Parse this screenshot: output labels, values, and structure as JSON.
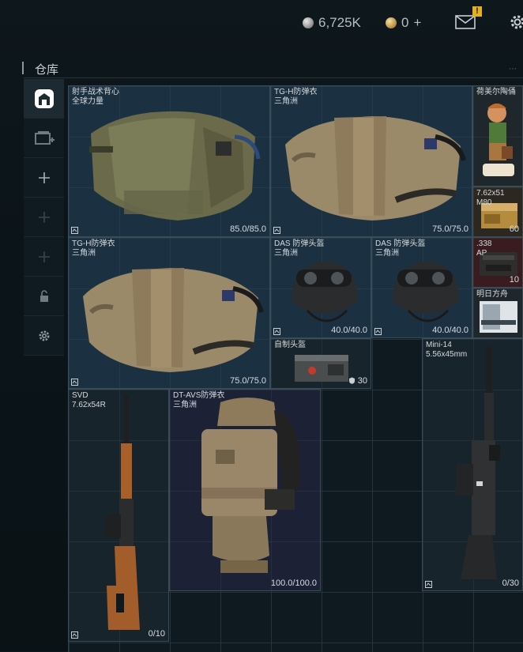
{
  "header": {
    "roubles": "6,725K",
    "coins": "0",
    "coins_add": "+",
    "mail_badge": "!",
    "icons": [
      "silver-coin-icon",
      "gold-coin-icon",
      "mail-icon",
      "settings-icon"
    ]
  },
  "section": {
    "title": "仓库",
    "dots": "⋯"
  },
  "sidebar": {
    "items": [
      {
        "name": "warehouse-tab",
        "icon": "warehouse-icon",
        "active": true
      },
      {
        "name": "add-storage-tab",
        "icon": "add-card-icon"
      },
      {
        "name": "add-slot-1",
        "icon": "plus-icon"
      },
      {
        "name": "add-slot-2",
        "icon": "plus-icon"
      },
      {
        "name": "add-slot-3",
        "icon": "plus-icon"
      },
      {
        "name": "lock-tab",
        "icon": "lock-icon"
      },
      {
        "name": "settings-tab",
        "icon": "gear-icon"
      }
    ]
  },
  "items": {
    "vest1": {
      "line1": "射手战术背心",
      "line2": "全球力量",
      "durability": "85.0/85.0"
    },
    "vest2": {
      "line1": "TG-H防弹衣",
      "line2": "三角洲",
      "durability": "75.0/75.0"
    },
    "vest3": {
      "line1": "TG-H防弹衣",
      "line2": "三角洲",
      "durability": "75.0/75.0"
    },
    "figurine": {
      "line1": "荷美尔陶俑"
    },
    "ammo762": {
      "line1": "7.62x51",
      "line2": "M80",
      "count": "60"
    },
    "ammo338": {
      "line1": ".338",
      "line2": "AP",
      "count": "10"
    },
    "card": {
      "line1": "明日方舟"
    },
    "helmet1": {
      "line1": "DAS 防弹头盔",
      "line2": "三角洲",
      "durability": "40.0/40.0"
    },
    "helmet2": {
      "line1": "DAS 防弹头盔",
      "line2": "三角洲",
      "durability": "40.0/40.0"
    },
    "homemade": {
      "line1": "自制头盔",
      "durability": "30"
    },
    "mini14": {
      "line1": "Mini-14",
      "line2": "5.56x45mm",
      "ammo": "0/30"
    },
    "svd": {
      "line1": "SVD",
      "line2": "7.62x54R",
      "ammo": "0/10"
    },
    "dtavs": {
      "line1": "DT-AVS防弹衣",
      "line2": "三角洲",
      "durability": "100.0/100.0"
    }
  }
}
